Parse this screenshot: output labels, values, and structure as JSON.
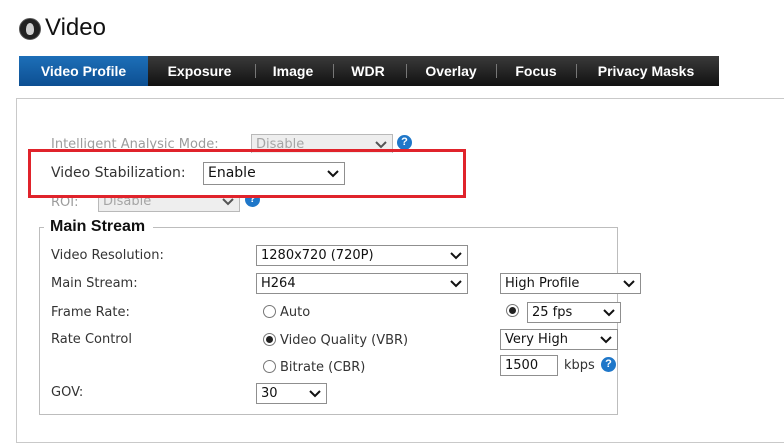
{
  "header": {
    "title": "Video"
  },
  "tabs": [
    {
      "label": "Video Profile",
      "active": true
    },
    {
      "label": "Exposure"
    },
    {
      "label": "Image"
    },
    {
      "label": "WDR"
    },
    {
      "label": "Overlay"
    },
    {
      "label": "Focus"
    },
    {
      "label": "Privacy Masks"
    }
  ],
  "settings": {
    "intelligent_analysis": {
      "label": "Intelligent Analysic Mode:",
      "value": "Disable"
    },
    "video_stabilization": {
      "label": "Video Stabilization:",
      "value": "Enable"
    },
    "roi": {
      "label": "ROI:",
      "value": "Disable"
    }
  },
  "main_stream": {
    "legend": "Main Stream",
    "video_resolution": {
      "label": "Video Resolution:",
      "value": "1280x720 (720P)"
    },
    "main_stream": {
      "label": "Main Stream:",
      "codec": "H264",
      "profile": "High Profile"
    },
    "frame_rate": {
      "label": "Frame Rate:",
      "auto_label": "Auto",
      "value": "25 fps",
      "selected": "fps"
    },
    "rate_control": {
      "label": "Rate Control",
      "vbr_label": "Video Quality (VBR)",
      "cbr_label": "Bitrate (CBR)",
      "selected": "vbr",
      "quality": "Very High",
      "bitrate": "1500",
      "bitrate_unit": "kbps"
    },
    "gov": {
      "label": "GOV:",
      "value": "30"
    }
  },
  "colors": {
    "accent": "#1d6fb8",
    "tabbar": "#1a1a1a",
    "highlight": "#e0232b",
    "help": "#1f77c9"
  },
  "icons": [
    "app-logo-icon",
    "chevron-down-icon",
    "help-icon"
  ]
}
